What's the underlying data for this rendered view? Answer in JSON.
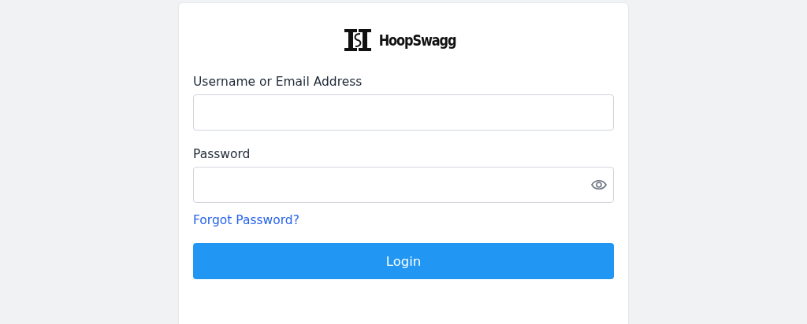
{
  "logo": {
    "text": "HoopSwagg"
  },
  "fields": [
    {
      "label": "Username or Email Address",
      "kind": "text"
    },
    {
      "label": "Password",
      "kind": "password"
    }
  ],
  "forgot_link": "Forgot Password?",
  "submit_button": "Login"
}
